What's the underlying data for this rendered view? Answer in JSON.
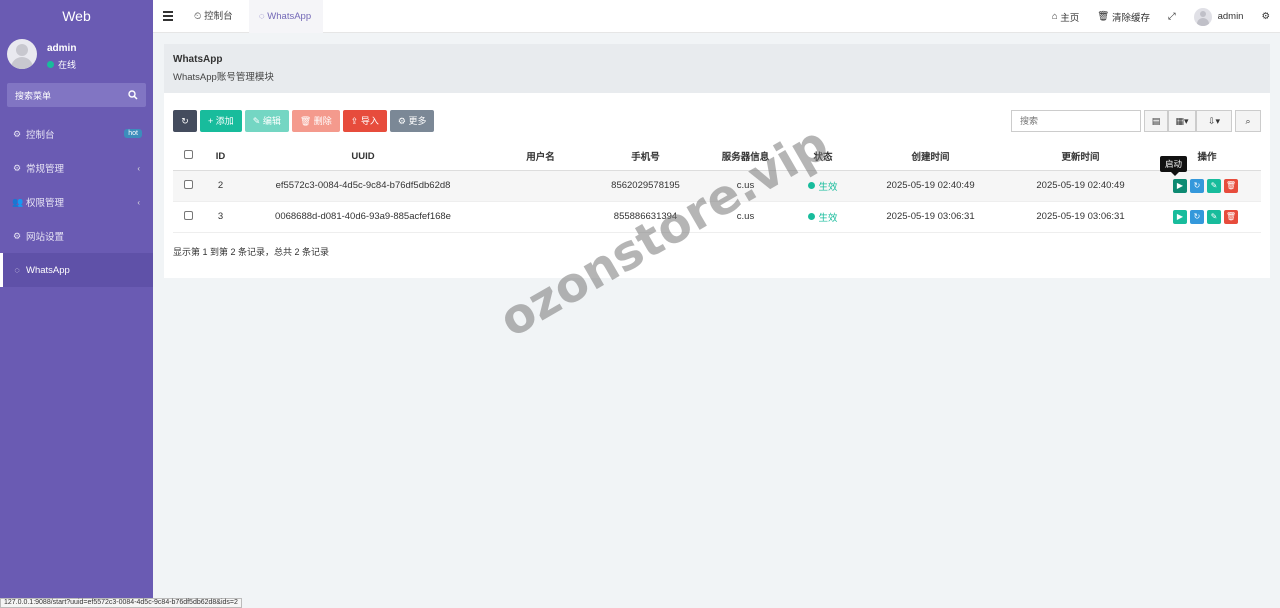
{
  "sidebar": {
    "brand": "Web",
    "user": {
      "name": "admin",
      "status": "在线"
    },
    "search_label": "搜索菜单",
    "items": [
      {
        "label": "控制台",
        "badge": "hot"
      },
      {
        "label": "常规管理"
      },
      {
        "label": "权限管理"
      },
      {
        "label": "网站设置"
      },
      {
        "label": "WhatsApp"
      }
    ]
  },
  "topbar": {
    "tabs": [
      {
        "label": "控制台"
      },
      {
        "label": "WhatsApp"
      }
    ],
    "home": "主页",
    "clear_cache": "清除缓存",
    "user": "admin"
  },
  "panel": {
    "title": "WhatsApp",
    "subtitle": "WhatsApp账号管理模块"
  },
  "toolbar": {
    "add": "添加",
    "edit": "编辑",
    "delete": "删除",
    "import": "导入",
    "more": "更多",
    "search_placeholder": "搜索"
  },
  "table": {
    "headers": [
      "ID",
      "UUID",
      "用户名",
      "手机号",
      "服务器信息",
      "状态",
      "创建时间",
      "更新时间",
      "操作"
    ],
    "rows": [
      {
        "id": "2",
        "uuid": "ef5572c3-0084-4d5c-9c84-b76df5db62d8",
        "username": "",
        "phone": "8562029578195",
        "server": "c.us",
        "status": "生效",
        "created": "2025-05-19 02:40:49",
        "updated": "2025-05-19 02:40:49"
      },
      {
        "id": "3",
        "uuid": "0068688d-d081-40d6-93a9-885acfef168e",
        "username": "",
        "phone": "855886631394",
        "server": "c.us",
        "status": "生效",
        "created": "2025-05-19 03:06:31",
        "updated": "2025-05-19 03:06:31"
      }
    ],
    "tooltip": "启动",
    "summary": "显示第 1 到第 2 条记录，总共 2 条记录"
  },
  "watermark": "ozonstore.vip",
  "statusbar": "127.0.0.1:9088/start?uuid=ef5572c3-0084-4d5c-9c84-b76df5db62d8&ids=2",
  "colors": {
    "sidebar": "#6a5bb3",
    "success": "#18bc9c",
    "danger": "#e74c3c",
    "info": "#3498db"
  }
}
